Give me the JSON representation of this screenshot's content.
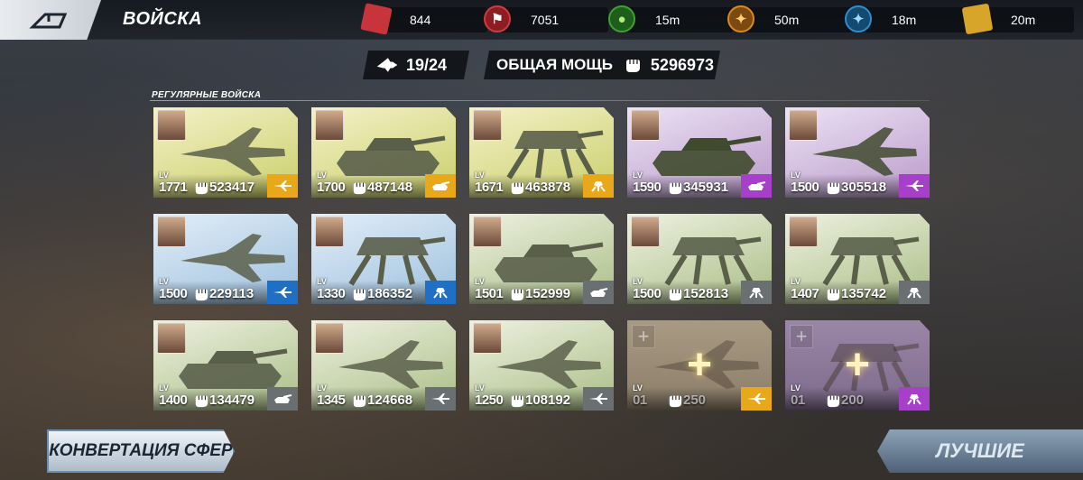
{
  "header": {
    "title": "ВОЙСКА",
    "resources": [
      {
        "icon": "red-cube-icon",
        "value": "844",
        "color": "#c8343b"
      },
      {
        "icon": "red-emblem-icon",
        "value": "7051",
        "color": "#b8282e"
      },
      {
        "icon": "green-orb-icon",
        "value": "15m",
        "color": "#3da32f"
      },
      {
        "icon": "orange-emblem-icon",
        "value": "50m",
        "color": "#d98a1a"
      },
      {
        "icon": "blue-emblem-icon",
        "value": "18m",
        "color": "#2b8fd0"
      },
      {
        "icon": "gold-crate-icon",
        "value": "20m",
        "color": "#d7a52a"
      }
    ]
  },
  "summary": {
    "troop_count": "19/24",
    "power_label": "ОБЩАЯ МОЩЬ",
    "power_value": "5296973"
  },
  "section": {
    "title": "РЕГУЛЯРНЫЕ ВОЙСКА"
  },
  "level_tag": "LV",
  "cards": [
    {
      "level": "1771",
      "power": "523417",
      "type": "aircraft",
      "rarity": "gold"
    },
    {
      "level": "1700",
      "power": "487148",
      "type": "tank",
      "rarity": "gold"
    },
    {
      "level": "1671",
      "power": "463878",
      "type": "mech",
      "rarity": "gold"
    },
    {
      "level": "1590",
      "power": "345931",
      "type": "tank",
      "rarity": "purple"
    },
    {
      "level": "1500",
      "power": "305518",
      "type": "aircraft",
      "rarity": "purple"
    },
    {
      "level": "1500",
      "power": "229113",
      "type": "aircraft",
      "rarity": "blue"
    },
    {
      "level": "1330",
      "power": "186352",
      "type": "mech",
      "rarity": "blue"
    },
    {
      "level": "1501",
      "power": "152999",
      "type": "tank",
      "rarity": "green"
    },
    {
      "level": "1500",
      "power": "152813",
      "type": "mech",
      "rarity": "green"
    },
    {
      "level": "1407",
      "power": "135742",
      "type": "mech",
      "rarity": "green"
    },
    {
      "level": "1400",
      "power": "134479",
      "type": "tank",
      "rarity": "green"
    },
    {
      "level": "1345",
      "power": "124668",
      "type": "aircraft",
      "rarity": "green"
    },
    {
      "level": "1250",
      "power": "108192",
      "type": "aircraft",
      "rarity": "green"
    },
    {
      "level": "01",
      "power": "250",
      "type": "aircraft",
      "rarity": "gold",
      "empty": true
    },
    {
      "level": "01",
      "power": "200",
      "type": "mech",
      "rarity": "purple",
      "empty": true
    }
  ],
  "buttons": {
    "convert": "КОНВЕРТАЦИЯ СФЕР",
    "best": "ЛУЧШИЕ"
  }
}
